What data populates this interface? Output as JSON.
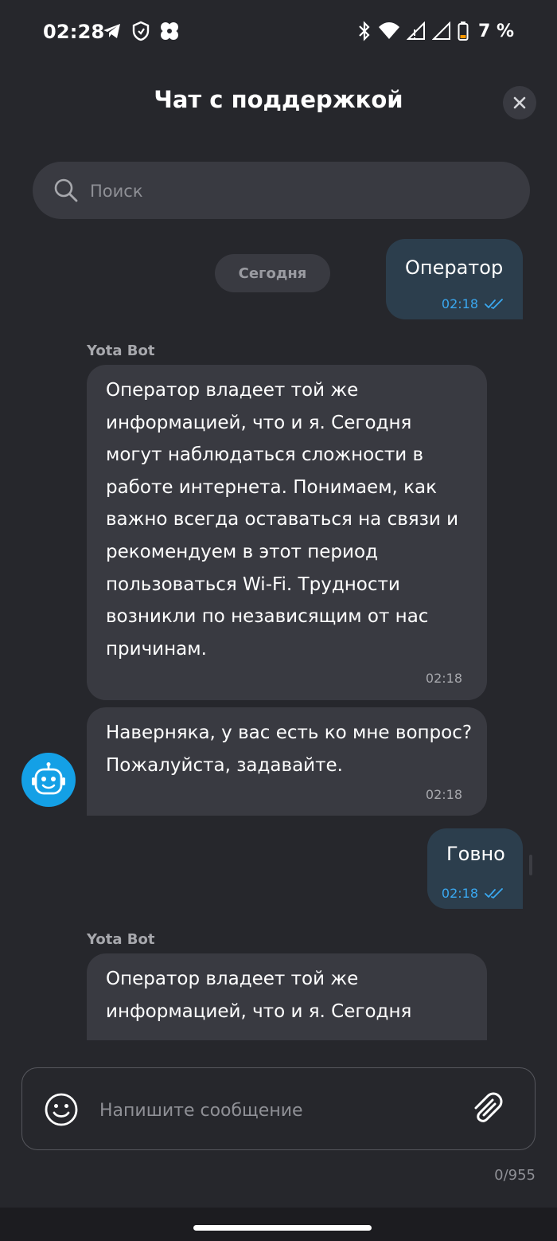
{
  "status_bar": {
    "time": "02:28",
    "battery": "7 %",
    "icons_left": [
      "telegram-icon",
      "shield-icon",
      "app-icon"
    ],
    "icons_right": [
      "bluetooth-icon",
      "wifi-icon",
      "signal-icon",
      "signal-icon",
      "battery-icon"
    ]
  },
  "header": {
    "title": "Чат с поддержкой",
    "close_icon": "close-icon"
  },
  "search": {
    "placeholder": "Поиск"
  },
  "chat": {
    "date_label": "Сегодня",
    "messages": [
      {
        "direction": "outgoing",
        "text": "Оператор",
        "time": "02:18",
        "status": "read"
      },
      {
        "direction": "incoming",
        "sender": "Yota Bot",
        "text": "Оператор владеет той же информацией, что и я. Сегодня могут наблюдаться сложности в работе интернета. Понимаем, как важно всегда оставаться на связи и рекомендуем в этот период пользоваться Wi-Fi. Трудности возникли по независящим от нас причинам.",
        "time": "02:18"
      },
      {
        "direction": "incoming",
        "text": "Наверняка, у вас есть ко мне вопрос? Пожалуйста, задавайте.",
        "time": "02:18"
      },
      {
        "direction": "outgoing",
        "text": "Говно",
        "time": "02:18",
        "status": "read"
      },
      {
        "direction": "incoming",
        "sender": "Yota Bot",
        "text": "Оператор владеет той же информацией, что и я. Сегодня"
      }
    ]
  },
  "composer": {
    "placeholder": "Напишите сообщение",
    "counter": "0/955"
  },
  "colors": {
    "background": "#26272c",
    "bubble_incoming": "#393a41",
    "bubble_outgoing": "#2c3e4d",
    "accent": "#3aa8f0",
    "avatar": "#14a0e6"
  }
}
